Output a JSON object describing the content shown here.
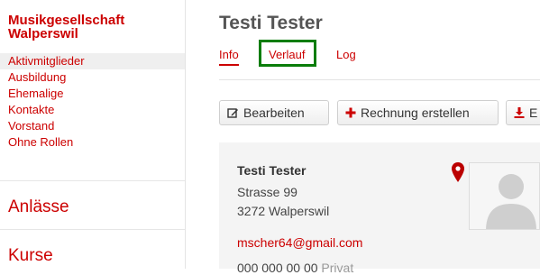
{
  "sidebar": {
    "org_name": "Musikgesellschaft Walperswil",
    "items": [
      {
        "label": "Aktivmitglieder"
      },
      {
        "label": "Ausbildung"
      },
      {
        "label": "Ehemalige"
      },
      {
        "label": "Kontakte"
      },
      {
        "label": "Vorstand"
      },
      {
        "label": "Ohne Rollen"
      }
    ],
    "sections": [
      {
        "label": "Anlässe"
      },
      {
        "label": "Kurse"
      }
    ]
  },
  "main": {
    "title": "Testi Tester",
    "tabs": [
      {
        "label": "Info"
      },
      {
        "label": "Verlauf"
      },
      {
        "label": "Log"
      }
    ],
    "buttons": {
      "edit": "Bearbeiten",
      "create_invoice": "Rechnung erstellen",
      "export": "E"
    },
    "card": {
      "name": "Testi Tester",
      "street": "Strasse 99",
      "city": "3272 Walperswil",
      "email": "mscher64@gmail.com",
      "phone": "000 000 00 00",
      "phone_type": "Privat"
    }
  },
  "colors": {
    "accent": "#cc0000",
    "highlight_box": "#0a7d0a"
  },
  "icons": [
    "edit-icon",
    "plus-icon",
    "download-icon",
    "map-marker-icon",
    "avatar-placeholder"
  ]
}
